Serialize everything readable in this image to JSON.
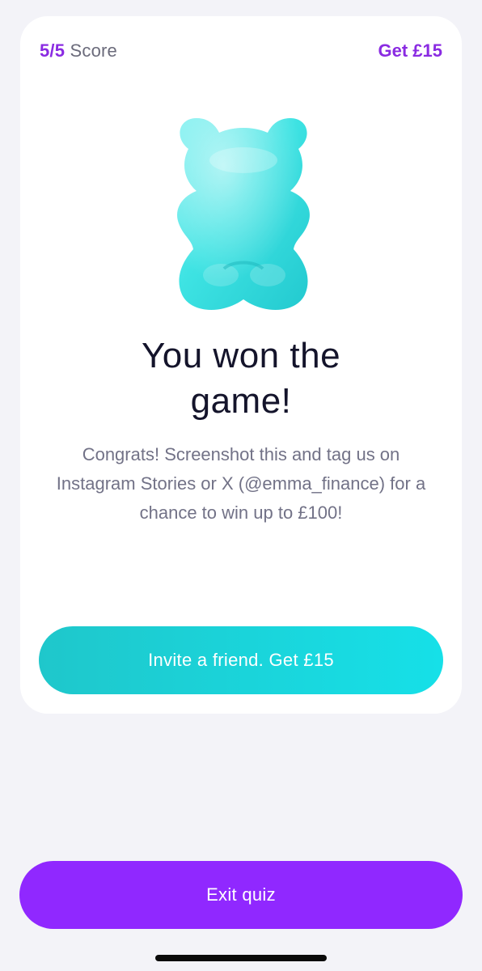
{
  "header": {
    "score_value": "5/5",
    "score_label": "Score",
    "get_label": "Get £15"
  },
  "illustration": {
    "icon": "gummy-bear-icon",
    "color": "#3fe0e0"
  },
  "result": {
    "title_line1": "You won the",
    "title_line2": "game!",
    "message": "Congrats! Screenshot this and tag us on Instagram Stories or X (@emma_finance) for a chance to win up to £100!"
  },
  "buttons": {
    "invite_label": "Invite a friend. Get £15",
    "exit_label": "Exit quiz"
  },
  "colors": {
    "accent_purple": "#9028ff",
    "accent_cyan": "#1fd5db",
    "background": "#f3f3f8"
  }
}
